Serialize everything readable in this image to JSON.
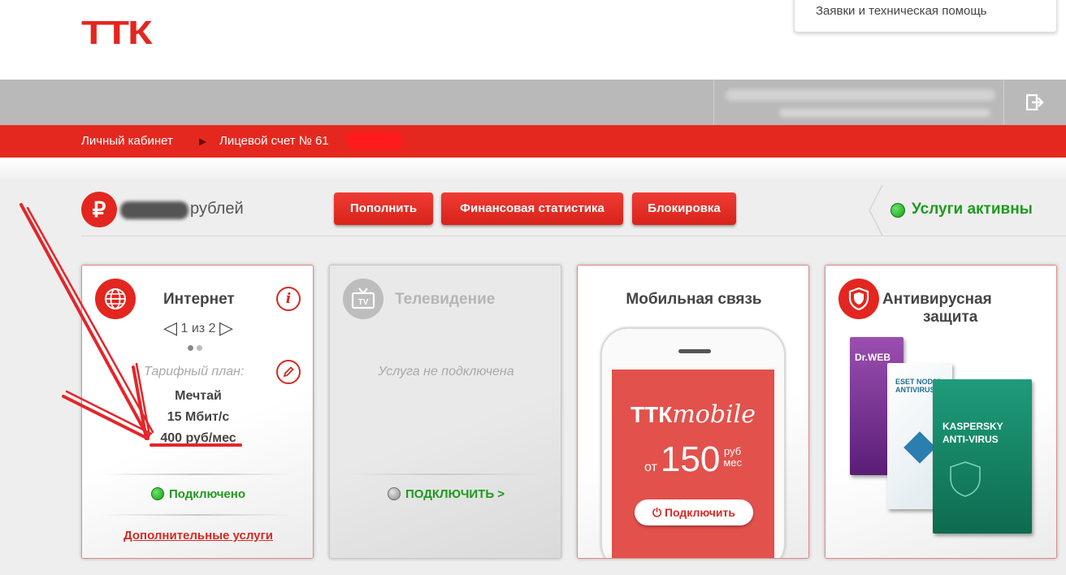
{
  "header": {
    "logo": "ТТК",
    "help_link": "Заявки и техническая помощь"
  },
  "breadcrumb": {
    "home": "Личный кабинет",
    "account": "Лицевой счет № 61"
  },
  "balance": {
    "currency_symbol": "₽",
    "label": "рублей"
  },
  "actions": {
    "topup": "Пополнить",
    "stats": "Финансовая статистика",
    "block": "Блокировка"
  },
  "services_status": "Услуги активны",
  "cards": {
    "internet": {
      "title": "Интернет",
      "pager": "1 из 2",
      "plan_label": "Тарифный план:",
      "plan_name": "Мечтай",
      "speed": "15 Мбит/с",
      "price": "400 руб/мес",
      "status": "Подключено",
      "extra_link": "Дополнительные услуги"
    },
    "tv": {
      "title": "Телевидение",
      "icon_text": "TV",
      "note": "Услуга не подключена",
      "connect": "ПОДКЛЮЧИТЬ >"
    },
    "mobile": {
      "title": "Мобильная связь",
      "brand": "ТТК",
      "brand_suffix": "mobile",
      "from": "от",
      "price": "150",
      "unit_top": "руб",
      "unit_bottom": "мес",
      "connect": "Подключить"
    },
    "antivirus": {
      "title_line1": "Антивирусная",
      "title_line2": "защита",
      "products": [
        "Dr.WEB",
        "ESET NOD32 ANTIVIRUS",
        "KASPERSKY ANTI-VIRUS"
      ]
    }
  },
  "colors": {
    "brand_red": "#e3261f",
    "status_green": "#1e9a1e",
    "gray_bar": "#b9b9b9"
  }
}
